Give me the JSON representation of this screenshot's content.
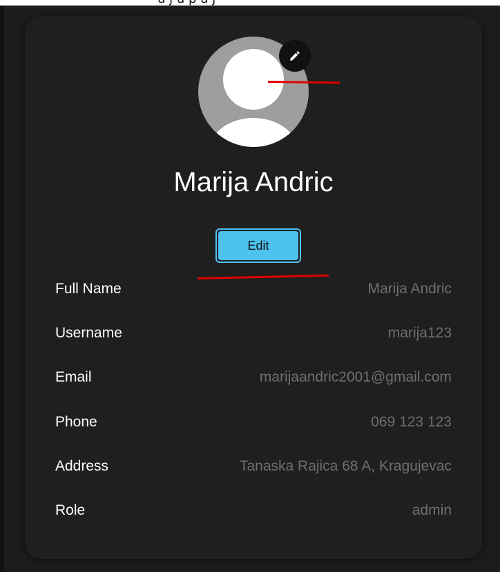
{
  "top_fragment_text": "u j u p u j",
  "profile": {
    "name": "Marija Andric",
    "edit_label": "Edit",
    "edit_avatar_icon": "pencil-icon"
  },
  "info": {
    "rows": [
      {
        "label": "Full Name",
        "value": "Marija Andric"
      },
      {
        "label": "Username",
        "value": "marija123"
      },
      {
        "label": "Email",
        "value": "marijaandric2001@gmail.com"
      },
      {
        "label": "Phone",
        "value": "069 123 123"
      },
      {
        "label": "Address",
        "value": "Tanaska Rajica 68 A, Kragujevac"
      },
      {
        "label": "Role",
        "value": "admin"
      }
    ]
  },
  "colors": {
    "background": "#1c1c1c",
    "card": "#1f1f1f",
    "accent": "#4cc3ef",
    "annotation": "#e00000",
    "muted_text": "#6f6f6f"
  }
}
